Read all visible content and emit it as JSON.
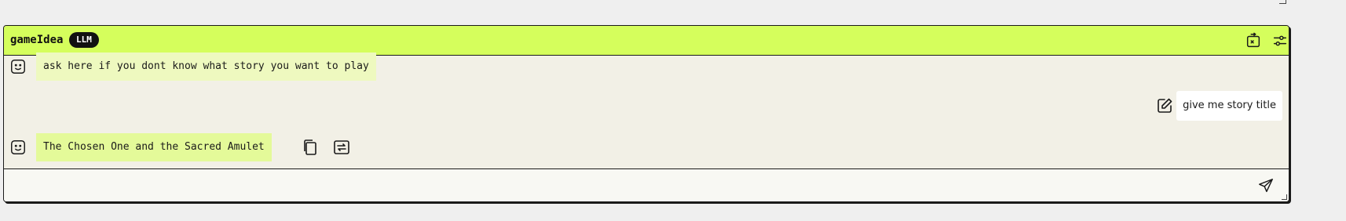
{
  "window": {
    "title": "gameIdea",
    "badge": "LLM"
  },
  "header_icons": [
    "rotate-screen-icon",
    "sliders-icon"
  ],
  "messages": [
    {
      "role": "assistant",
      "text": "ask here if you dont know what story you want to play",
      "avatar_icon": "smiley-face-icon"
    },
    {
      "role": "user",
      "text": "give me story title",
      "action_icon": "edit-icon"
    },
    {
      "role": "assistant",
      "text": "The Chosen One and the Sacred Amulet",
      "avatar_icon": "smiley-face-icon",
      "action_icons": [
        "copy-icon",
        "regenerate-icon"
      ]
    }
  ],
  "input": {
    "value": "",
    "placeholder": "",
    "send_icon": "send-icon"
  },
  "colors": {
    "header_bg": "#d5fe5c",
    "badge_bg": "#111111",
    "chat_bg": "#f2f0e6",
    "bot_bubble": "#eef9bf",
    "bot_bubble_latest": "#e4fa99"
  }
}
